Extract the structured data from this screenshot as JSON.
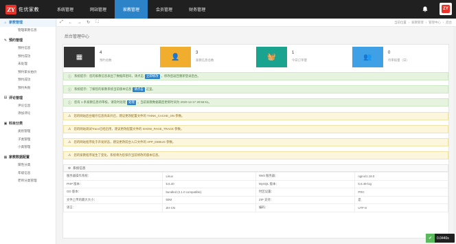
{
  "app": {
    "logo_text": "佐优家教",
    "logo_mark": "ZY"
  },
  "nav": [
    "系统管理",
    "网站管理",
    "家教管理",
    "会员管理",
    "财务管理"
  ],
  "nav_active_index": 2,
  "sidebar": {
    "groups": [
      {
        "title": "家教管理",
        "icon": "home-icon",
        "active": true,
        "items": [
          "管理家教信息"
        ]
      },
      {
        "title": "预约管理",
        "icon": "pencil-icon",
        "items": [
          "预约信息",
          "预约成功",
          "未处理",
          "预约家长拍价",
          "预约成功",
          "预约失败"
        ]
      },
      {
        "title": "评论管理",
        "icon": "comment-icon",
        "items": [
          "评论信息",
          "添加评论"
        ]
      },
      {
        "title": "科目分类",
        "icon": "folder-icon",
        "items": [
          "类别管理",
          "子类管理",
          "小类管理"
        ]
      },
      {
        "title": "家教数据配置",
        "icon": "grid-icon",
        "items": [
          "属性分类",
          "年级信息",
          "老师分类管理"
        ]
      }
    ]
  },
  "toolbar": {
    "icons": [
      "expand-icon",
      "back-icon",
      "forward-icon",
      "refresh-icon",
      "fullscreen-icon"
    ]
  },
  "breadcrumb": [
    "当前位置",
    "家教管理",
    "管理中心",
    "后台"
  ],
  "page_title": "后台管理中心",
  "cards": [
    {
      "value": "4",
      "label": "预约总数",
      "color": "#333333",
      "icon": "calendar-icon"
    },
    {
      "value": "3",
      "label": "家教信息总数",
      "color": "#f0ad2e",
      "icon": "user-icon"
    },
    {
      "value": "1",
      "label": "今日订单量",
      "color": "#1aa38f",
      "icon": "basket-icon"
    },
    {
      "value": "0",
      "label": "待审核量（日）",
      "color": "#3fa0e6",
      "icon": "group-icon"
    }
  ],
  "alerts": [
    {
      "type": "green",
      "pre": "系统提示：您的家教信息表出了数据库密码，请点击",
      "tag": "立即修改",
      "post": "，修改后返回重新登录后台。"
    },
    {
      "type": "green",
      "pre": "系统提示：了解您的家教系统当前版本信息 ",
      "tag": "请点击",
      "post": "这里。"
    },
    {
      "type": "green",
      "pre": "您有 1 条家教信息待审核，请及时处理",
      "tag": "处理",
      "post": "，当前家教数据最后更新时间为 2020-12-17 20:56:51。"
    },
    {
      "type": "yellow",
      "pre": "您的网站后台缓存信息尚未开启，建议更改配置文件的 THINK_CACHE_ON 参数。",
      "tag": "",
      "post": ""
    },
    {
      "type": "yellow",
      "pre": "您的网站调试Trace已经启用，建议更改配置文件的 SHOW_PAGE_TRACE 参数。",
      "tag": "",
      "post": ""
    },
    {
      "type": "yellow",
      "pre": "您的网站程序处于开发状态，建议更改前台入口文件的 APP_DEBUG 参数。",
      "tag": "",
      "post": ""
    },
    {
      "type": "yellow",
      "pre": "您的家教程序发生了变化，系统将为您保存当前修改的版本信息。",
      "tag": "",
      "post": ""
    }
  ],
  "sys_info": {
    "title": "系统信息",
    "rows": [
      [
        "服务器操作系统：",
        "Linux",
        "Web 服务器：",
        "nginx/1.18.0"
      ],
      [
        "PHP 版本：",
        "5.6.40",
        "MySQL 版本：",
        "5.6.49-log"
      ],
      [
        "GD 版本：",
        "bundled (2.1.0 compatible)",
        "时区设置：",
        "PRC"
      ],
      [
        "文件上传的最大大小：",
        "50M",
        "ZIP 支持：",
        "是"
      ],
      [
        "语言：",
        "ZH-CN",
        "编码：",
        "UTF-8"
      ]
    ]
  },
  "speed": {
    "value": "0.0440s"
  }
}
